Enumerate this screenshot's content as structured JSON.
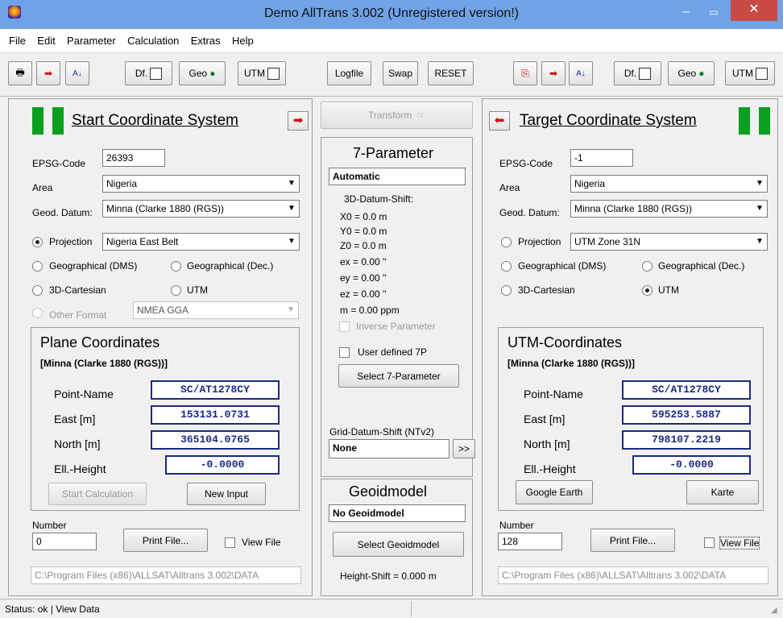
{
  "window": {
    "title": "Demo AllTrans 3.002 (Unregistered version!)",
    "min": "–",
    "max": "▭",
    "close": "✕"
  },
  "menu": [
    "File",
    "Edit",
    "Parameter",
    "Calculation",
    "Extras",
    "Help"
  ],
  "toolbar": {
    "left": {
      "df": "Df.",
      "geo": "Geo",
      "utm": "UTM"
    },
    "center": {
      "logfile": "Logfile",
      "swap": "Swap",
      "reset": "RESET"
    },
    "right": {
      "df": "Df.",
      "geo": "Geo",
      "utm": "UTM"
    }
  },
  "start": {
    "title": "Start Coordinate System",
    "epsg_label": "EPSG-Code",
    "epsg": "26393",
    "area_label": "Area",
    "area": "Nigeria",
    "datum_label": "Geod. Datum:",
    "datum": "Minna (Clarke 1880 (RGS))",
    "projection_label": "Projection",
    "projection": "Nigeria East Belt",
    "geo_dms": "Geographical (DMS)",
    "geo_dec": "Geographical (Dec.)",
    "cartesian": "3D-Cartesian",
    "utm": "UTM",
    "other_format": "Other Format",
    "other_value": "NMEA GGA",
    "coords_title": "Plane Coordinates",
    "coords_datum": "[Minna (Clarke 1880 (RGS))]",
    "point_label": "Point-Name",
    "point": "SC/AT1278CY",
    "east_label": "East [m]",
    "east": "153131.0731",
    "north_label": "North [m]",
    "north": "365104.0765",
    "height_label": "Ell.-Height",
    "height": "-0.0000",
    "start_calc": "Start Calculation",
    "new_input": "New Input",
    "number_label": "Number",
    "number": "0",
    "print": "Print File...",
    "view": "View File",
    "path": "C:\\Program Files (x86)\\ALLSAT\\Alltrans 3.002\\DATA"
  },
  "middle": {
    "transform": "Transform",
    "seven_title": "7-Parameter",
    "seven_mode": "Automatic",
    "shift_title": "3D-Datum-Shift:",
    "params": [
      "X0 =   0.0 m",
      "Y0 =   0.0 m",
      "Z0 =   0.0 m",
      "ex =  0.00 ''",
      "ey =  0.00 ''",
      "ez =  0.00 ''",
      "m =  0.00 ppm"
    ],
    "inverse": "Inverse Parameter",
    "user7p": "User defined 7P",
    "select7": "Select 7-Parameter",
    "grid_label": "Grid-Datum-Shift (NTv2)",
    "grid_value": "None",
    "grid_btn": ">>",
    "geoid_title": "Geoidmodel",
    "geoid_value": "No Geoidmodel",
    "select_geoid": "Select Geoidmodel",
    "height_shift": "Height-Shift  = 0.000 m"
  },
  "target": {
    "title": "Target Coordinate System",
    "epsg_label": "EPSG-Code",
    "epsg": "-1",
    "area_label": "Area",
    "area": "Nigeria",
    "datum_label": "Geod. Datum:",
    "datum": "Minna (Clarke 1880 (RGS))",
    "projection_label": "Projection",
    "projection": "UTM Zone 31N",
    "geo_dms": "Geographical (DMS)",
    "geo_dec": "Geographical (Dec.)",
    "cartesian": "3D-Cartesian",
    "utm": "UTM",
    "coords_title": "UTM-Coordinates",
    "coords_datum": "[Minna (Clarke 1880 (RGS))]",
    "point_label": "Point-Name",
    "point": "SC/AT1278CY",
    "east_label": "East [m]",
    "east": "595253.5887",
    "north_label": "North [m]",
    "north": "798107.2219",
    "height_label": "Ell.-Height",
    "height": "-0.0000",
    "google": "Google Earth",
    "karte": "Karte",
    "number_label": "Number",
    "number": "128",
    "print": "Print File...",
    "view": "View File",
    "path": "C:\\Program Files (x86)\\ALLSAT\\Alltrans 3.002\\DATA"
  },
  "status": "Status: ok | View Data",
  "colors": {
    "titlebar": "#70a2e6",
    "close": "#c74a45",
    "green": "#0a9f1f",
    "value": "#1b2a80",
    "arrow": "#e00000"
  }
}
